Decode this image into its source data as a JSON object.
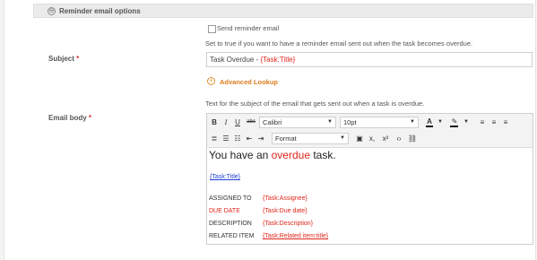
{
  "section": {
    "title": "Reminder email options",
    "toggle_glyph": "⊖"
  },
  "send_reminder": {
    "label": "Send reminder email",
    "checked": false,
    "help": "Set to true if you want to have a reminder email sent out when the task becomes overdue."
  },
  "subject": {
    "label": "Subject",
    "required_mark": "*",
    "value_prefix": "Task Overdue - ",
    "value_token": "{Task:Title}",
    "advanced_lookup": "Advanced Lookup",
    "help": "Text for the subject of the email that gets sent out when a task is overdue."
  },
  "email_body": {
    "label": "Email body",
    "required_mark": "*",
    "toolbar": {
      "bold": "B",
      "italic": "I",
      "underline": "U",
      "strike": "abc",
      "font": "Calibri",
      "size": "10pt",
      "format": "Format",
      "subscript": "x,",
      "superscript": "x²",
      "source": "‹›"
    },
    "content": {
      "heading_before": "You have an ",
      "heading_red": "overdue",
      "heading_after": " task.",
      "title_token": "{Task:Title}",
      "rows": [
        {
          "label": "ASSIGNED TO",
          "value": "{Task:Assignee}",
          "label_color": "#333333",
          "link": false
        },
        {
          "label": "DUE DATE",
          "value": "{Task:Due date}",
          "label_color": "#e0261b",
          "link": false
        },
        {
          "label": "DESCRIPTION",
          "value": "{Task:Description}",
          "label_color": "#333333",
          "link": false
        },
        {
          "label": "RELATED ITEM",
          "value": "{Task:Related item:title}",
          "label_color": "#333333",
          "link": true
        }
      ]
    }
  },
  "colors": {
    "accent_orange": "#e07b1e",
    "required_red": "#d9342b",
    "token_red": "#e0261b",
    "link_blue": "#1d3fd3"
  }
}
